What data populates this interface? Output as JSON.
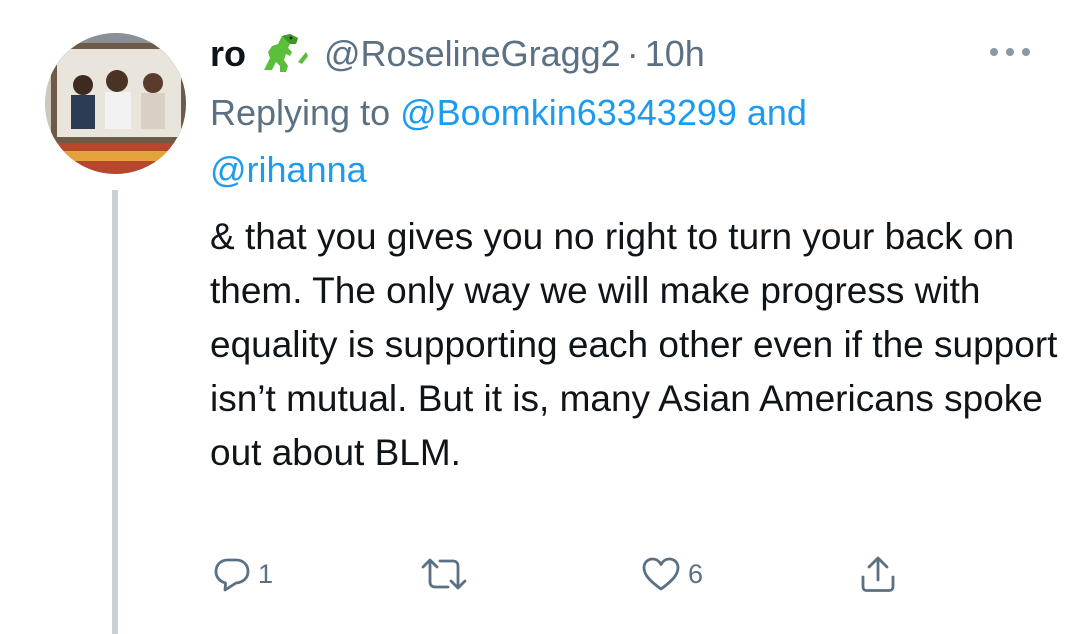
{
  "tweet": {
    "author_name": "ro",
    "author_emoji": "dinosaur-emoji",
    "handle": "@RoselineGragg2",
    "separator": "·",
    "time": "10h",
    "replying_prefix": "Replying to ",
    "replying_mention_1": "@Boomkin63343299",
    "replying_and": " and ",
    "replying_mention_2": "@rihanna",
    "text": "& that you gives you no right to turn your back on them. The only way we will make progress with equality is supporting each other even if the support isn’t mutual. But it is, many Asian Americans spoke out about BLM.",
    "reply_count": "1",
    "retweet_count": "",
    "like_count": "6"
  },
  "icons": {
    "more": "more-horizontal-icon",
    "reply": "reply-icon",
    "retweet": "retweet-icon",
    "like": "heart-icon",
    "share": "share-icon"
  },
  "colors": {
    "text": "#0f1419",
    "secondary": "#5b7083",
    "link": "#1d9bf0",
    "thread_line": "#c9d0d6"
  }
}
